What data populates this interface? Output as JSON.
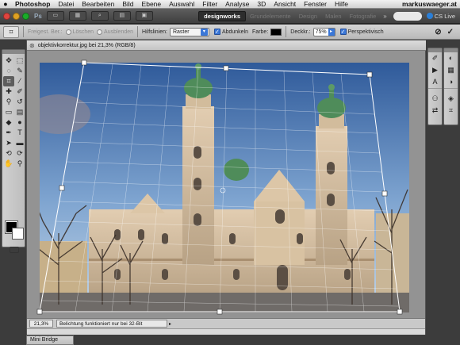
{
  "menubar": {
    "apple": "",
    "app_name": "Photoshop",
    "items": [
      "Datei",
      "Bearbeiten",
      "Bild",
      "Ebene",
      "Auswahl",
      "Filter",
      "Analyse",
      "3D",
      "Ansicht",
      "Fenster",
      "Hilfe"
    ],
    "right_text": "markuswaeger.at"
  },
  "appbar": {
    "logo": "Ps",
    "workspace_active": "designworks",
    "workspace_tabs": [
      "Grundelemente",
      "Design",
      "Malen",
      "Fotografie"
    ],
    "more": "»",
    "cs_live": "CS Live"
  },
  "options": {
    "grid_size_label": "Freigest. Ber.:",
    "radio_delete": "Löschen",
    "radio_hide": "Ausblenden",
    "overlay_label": "Hilfslinien:",
    "overlay_value": "Raster",
    "shield_label": "Abdunkeln",
    "color_label": "Farbe:",
    "opacity_label": "Deckkr.:",
    "opacity_value": "75%",
    "perspective_label": "Perspektivisch",
    "cancel_glyph": "⊘",
    "commit_glyph": "✓"
  },
  "document": {
    "tab_title": "objektivkorrektur.jpg bei 21,3% (RGB/8)",
    "zoom": "21,3%",
    "status_info": "Belichtung funktioniert nur bei 32-Bit",
    "status_more": "▸"
  },
  "minibridge": {
    "label": "Mini Bridge"
  },
  "colors": {
    "sky_top": "#2f5a9a",
    "sky_bottom": "#b9cfe4",
    "facade": "#d6bfa0",
    "dome": "#4f8c5a",
    "accent": "#3b78d8"
  }
}
